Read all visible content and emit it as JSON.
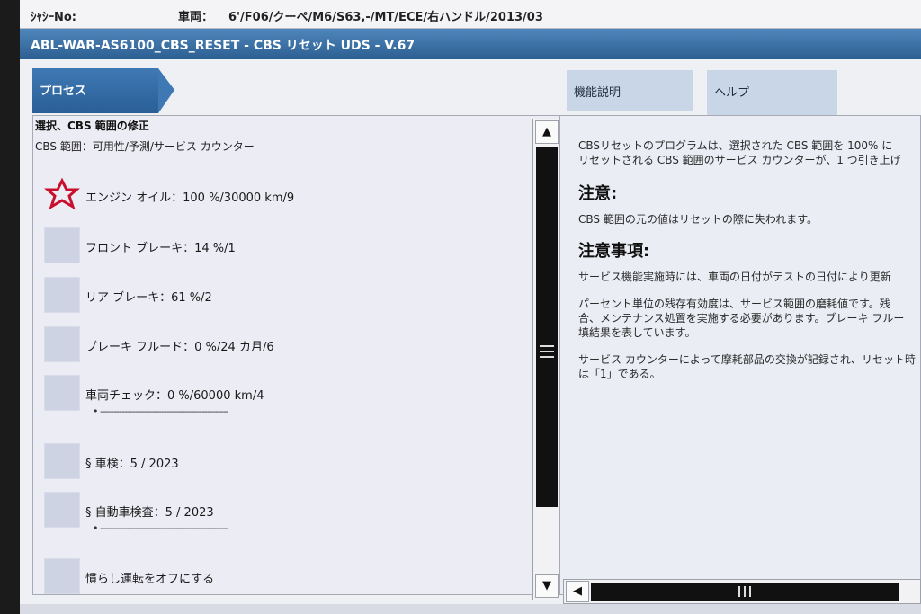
{
  "header": {
    "chassis_label": "ｼｬｼｰNo:",
    "vehicle_label": "車両：",
    "vehicle_value": "6'/F06/クーペ/M6/S63,-/MT/ECE/右ハンドル/2013/03"
  },
  "title": "ABL-WAR-AS6100_CBS_RESET - CBS リセット UDS - V.67",
  "tabs": {
    "process": "プロセス",
    "function": "機能説明",
    "help": "ヘルプ"
  },
  "left": {
    "title": "選択、CBS 範囲の修正",
    "subtitle": "CBS 範囲：可用性/予測/サービス カウンター",
    "items": [
      {
        "label": "エンジン オイル：100 %/30000 km/9",
        "icon": "warning-star-icon"
      },
      {
        "label": "フロント ブレーキ：14 %/1"
      },
      {
        "label": "リア ブレーキ：61 %/2"
      },
      {
        "label": "ブレーキ フルード：0 %/24 カ月/6"
      },
      {
        "label": "車両チェック：0 %/60000 km/4",
        "dash": "• ------------------------------------------------"
      },
      {
        "label": "§ 車検：5 / 2023"
      },
      {
        "label": "§ 自動車検査：5 / 2023",
        "dash": "• ------------------------------------------------"
      },
      {
        "label": "慣らし運転をオフにする"
      }
    ]
  },
  "right": {
    "line1": "CBSリセットのプログラムは、選択された CBS 範囲を 100% に",
    "line2": "リセットされる CBS 範囲のサービス カウンターが、1 つ引き上げ",
    "heading_caution": "注意:",
    "caution_text": "CBS 範囲の元の値はリセットの際に失われます。",
    "heading_notes": "注意事項:",
    "notes1": "サービス機能実施時には、車両の日付がテストの日付により更新",
    "notes2": "パーセント単位の残存有効度は、サービス範囲の磨耗値です。残",
    "notes3": "合、メンテナンス処置を実施する必要があります。ブレーキ フルー",
    "notes4": "填結果を表しています。",
    "notes5": "サービス カウンターによって摩耗部品の交換が記録され、リセット時",
    "notes6": "は「1」である。"
  },
  "icons": {
    "alert_color": "#c8102e",
    "titlebar_color": "#2c5f92"
  }
}
